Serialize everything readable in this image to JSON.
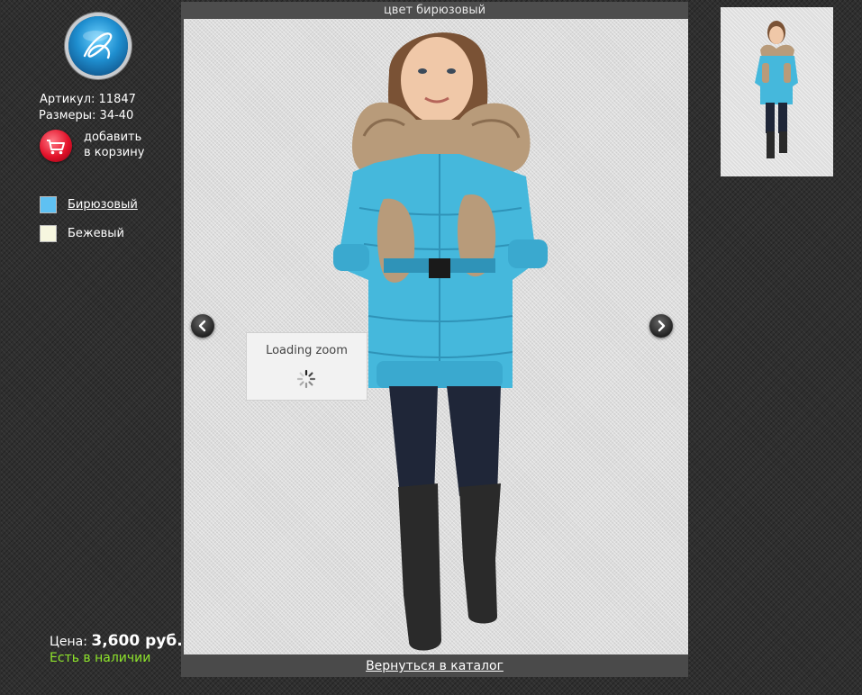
{
  "product": {
    "sku_line": "Артикул: 11847",
    "sizes_line": "Размеры: 34-40",
    "cart_label_line1": "добавить",
    "cart_label_line2": "в корзину"
  },
  "colors": {
    "title": "цвет бирюзовый",
    "items": [
      {
        "label": "Бирюзовый",
        "swatch": "#5fc1f2",
        "active": true
      },
      {
        "label": "Бежевый",
        "swatch": "#f6f6df",
        "active": false
      }
    ]
  },
  "price": {
    "label": "Цена:",
    "value": "3,600 руб.",
    "stock": "Есть в наличии"
  },
  "viewer": {
    "loading_text": "Loading zoom",
    "back_link": "Вернуться в каталог"
  },
  "icons": {
    "logo": "logo-icon",
    "cart": "cart-icon",
    "prev": "arrow-left-icon",
    "next": "arrow-right-icon",
    "spinner": "spinner-icon"
  },
  "palette": {
    "background": "#2f2f2f",
    "stock_green": "#8ee42b",
    "cart_red": "#e3122a",
    "jacket": "#45b8dc"
  }
}
